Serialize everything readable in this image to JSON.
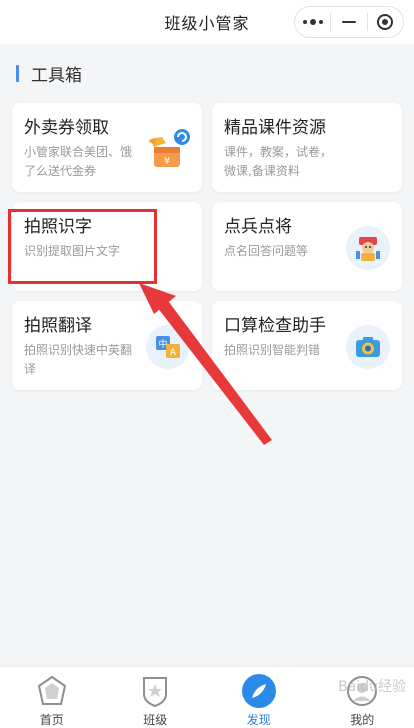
{
  "header": {
    "title": "班级小管家"
  },
  "section": {
    "title": "工具箱"
  },
  "cards": [
    {
      "title": "外卖券领取",
      "desc": "小管家联合美团、饿了么送代金券",
      "icon": "coupon-icon"
    },
    {
      "title": "精品课件资源",
      "desc": "课件，教案，试卷，微课,备课资料",
      "icon": ""
    },
    {
      "title": "拍照识字",
      "desc": "识别提取图片文字",
      "icon": ""
    },
    {
      "title": "点兵点将",
      "desc": "点名回答问题等",
      "icon": "roll-call-icon"
    },
    {
      "title": "拍照翻译",
      "desc": "拍照识别快速中英翻译",
      "icon": "translate-icon"
    },
    {
      "title": "口算检查助手",
      "desc": "拍照识别智能判错",
      "icon": "camera-icon"
    }
  ],
  "tabbar": [
    {
      "label": "首页",
      "icon": "home-icon"
    },
    {
      "label": "班级",
      "icon": "class-icon"
    },
    {
      "label": "发现",
      "icon": "discover-icon",
      "active": true
    },
    {
      "label": "我的",
      "icon": "profile-icon"
    }
  ],
  "colors": {
    "accent": "#2b7fe0",
    "annotation": "#e5302f",
    "section_bar": "#4e8ce6"
  },
  "watermark": "Baidu经验"
}
